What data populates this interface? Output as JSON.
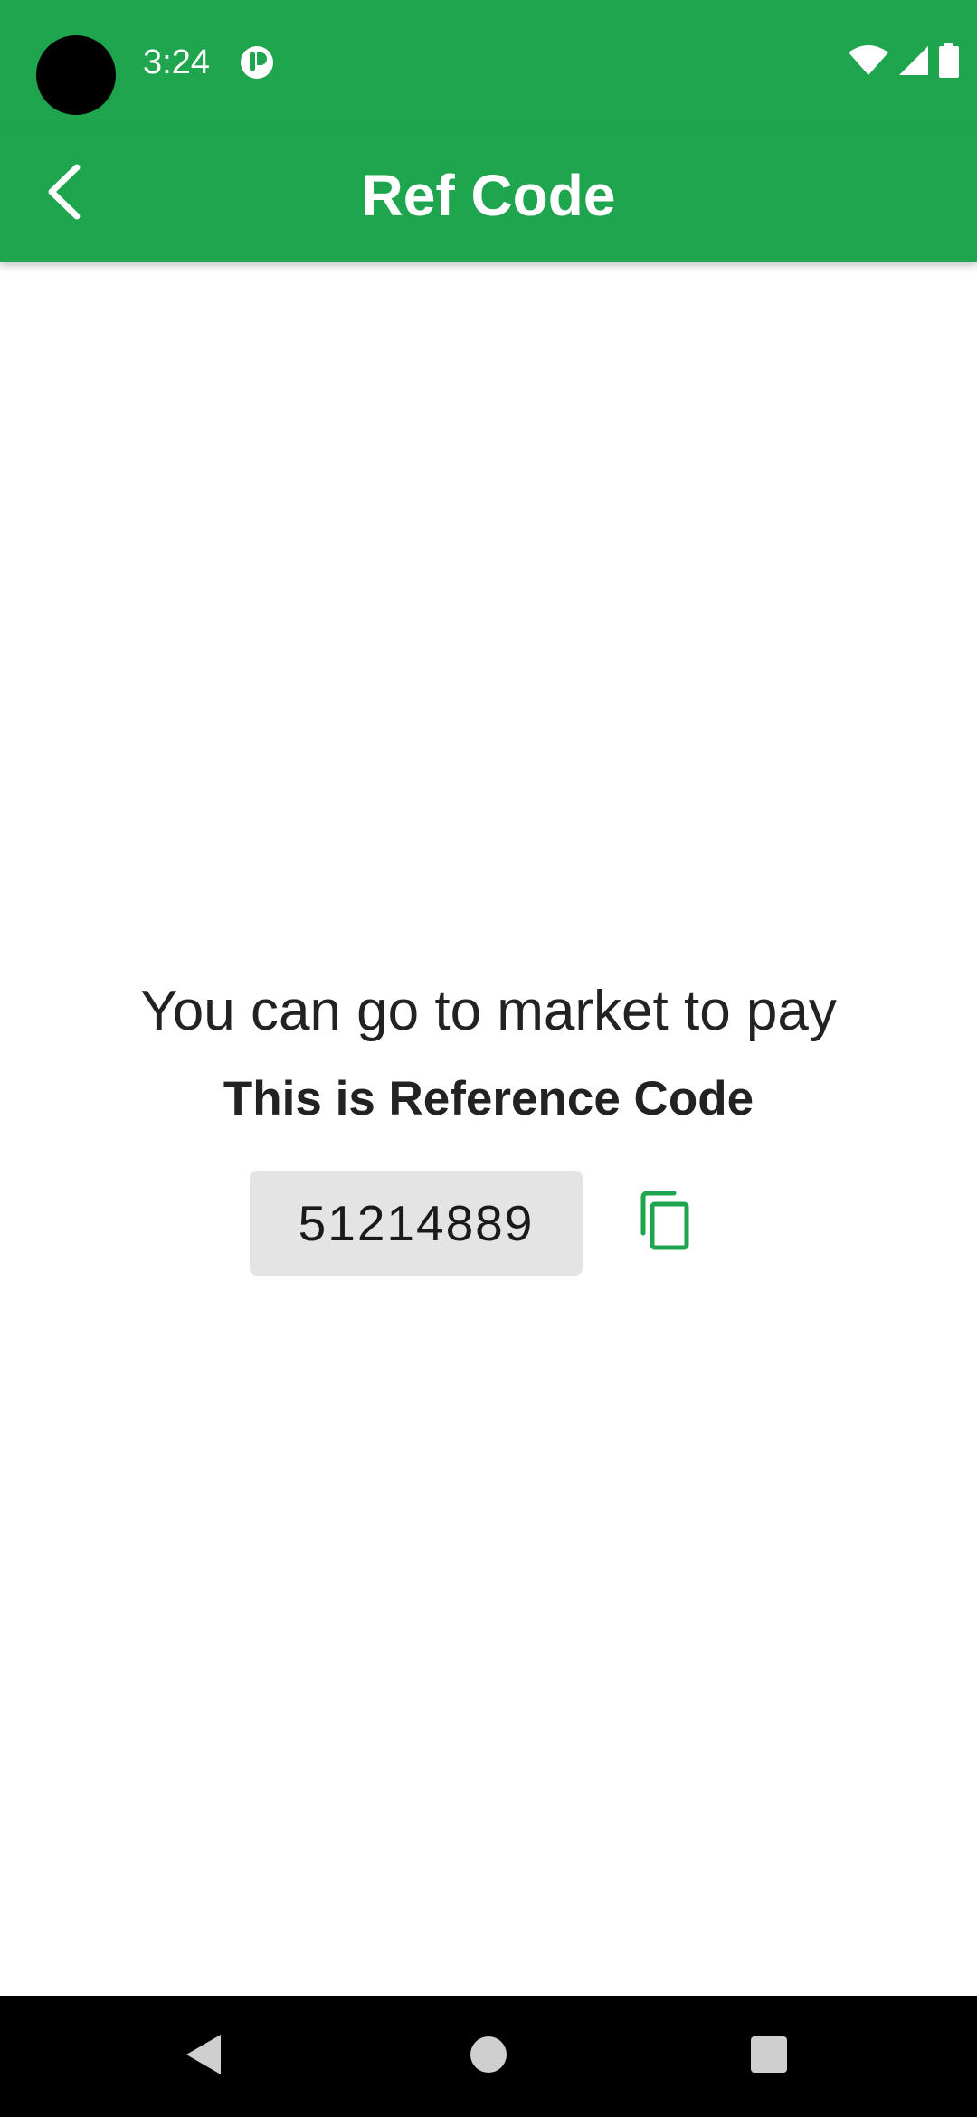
{
  "status_bar": {
    "time": "3:24",
    "icons": [
      "camera-cutout",
      "app-notification-icon",
      "wifi-icon",
      "cellular-signal-icon",
      "battery-icon"
    ]
  },
  "app_bar": {
    "title": "Ref Code",
    "back_icon": "chevron-left-icon"
  },
  "content": {
    "headline": "You can go to market to pay",
    "subheadline": "This is Reference Code",
    "reference_code": "51214889",
    "copy_icon": "copy-icon"
  },
  "nav_bar": {
    "icons": [
      "nav-back-icon",
      "nav-home-icon",
      "nav-recents-icon"
    ]
  },
  "colors": {
    "primary": "#1fa54d",
    "code_background": "#e4e4e4",
    "text": "#222222"
  }
}
